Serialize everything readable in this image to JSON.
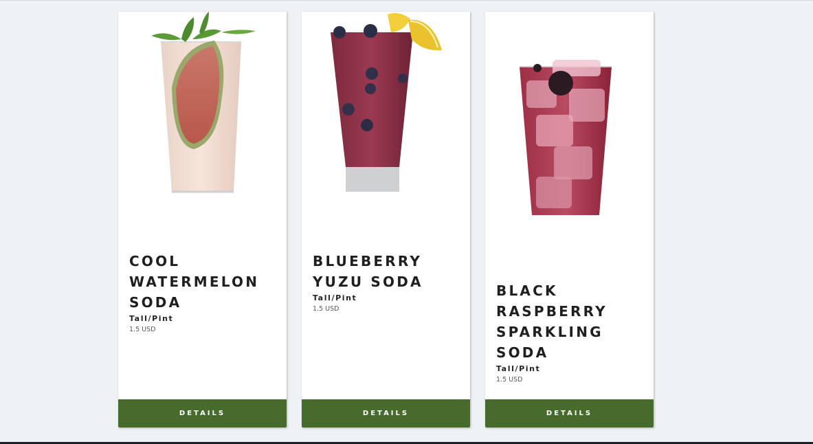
{
  "products": [
    {
      "name": "COOL WATERMELON SODA",
      "size": "Tall/Pint",
      "price": "1.5 USD",
      "button_label": "DETAILS",
      "image": "watermelon-soda-image"
    },
    {
      "name": "BLUEBERRY YUZU SODA",
      "size": "Tall/Pint",
      "price": "1.5 USD",
      "button_label": "DETAILS",
      "image": "blueberry-yuzu-soda-image"
    },
    {
      "name": "BLACK RASPBERRY SPARKLING SODA",
      "size": "Tall/Pint",
      "price": "1.5 USD",
      "button_label": "DETAILS",
      "image": "black-raspberry-soda-image"
    }
  ],
  "colors": {
    "page_background": "#eef2f5",
    "card_background": "#ffffff",
    "button_background": "#476b2d",
    "button_text": "#ffffff",
    "title_text": "#1f1f1f"
  }
}
